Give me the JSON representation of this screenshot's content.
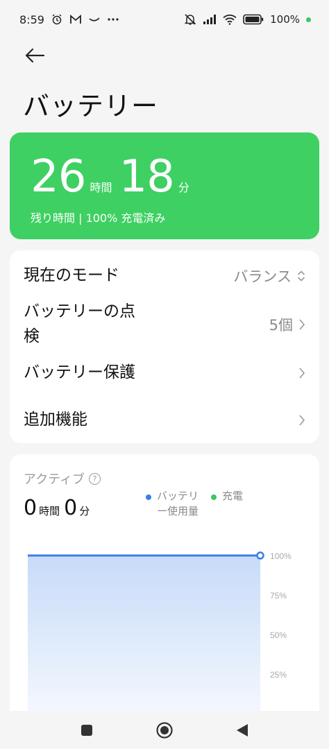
{
  "status_bar": {
    "time": "8:59",
    "battery_text": "100%",
    "icons": [
      "alarm-icon",
      "gmail-icon",
      "tilde-icon",
      "more-icon",
      "mute-icon",
      "signal-icon",
      "wifi-icon",
      "battery-icon"
    ]
  },
  "header": {
    "back_icon": "arrow-left-icon",
    "title": "バッテリー"
  },
  "battery_card": {
    "hours": "26",
    "hours_unit": "時間",
    "minutes": "18",
    "minutes_unit": "分",
    "subtitle": "残り時間 | 100% 充電済み",
    "color": "#3ed062"
  },
  "settings": {
    "mode_label": "現在のモード",
    "mode_value": "バランス",
    "check_label_line1": "バッテリーの点",
    "check_label_line2": "検",
    "check_value": "5個",
    "protect_label": "バッテリー保護",
    "extra_label": "追加機能"
  },
  "active": {
    "title": "アクティブ",
    "hours": "0",
    "hours_unit": "時間",
    "minutes": "0",
    "minutes_unit": "分",
    "legend_usage_line1": "バッテリ",
    "legend_usage_line2": "ー使用量",
    "legend_charge": "充電",
    "usage_color": "#3b7ee6",
    "charge_color": "#3ec464"
  },
  "chart_data": {
    "type": "area",
    "series": [
      {
        "name": "バッテリー使用量",
        "values": [
          100,
          100
        ]
      }
    ],
    "y_tick_labels": [
      "100%",
      "75%",
      "50%",
      "25%"
    ],
    "ylim": [
      0,
      100
    ],
    "grid": true
  },
  "nav_bar": {
    "icons": [
      "recent-apps-icon",
      "home-icon",
      "back-triangle-icon"
    ]
  }
}
